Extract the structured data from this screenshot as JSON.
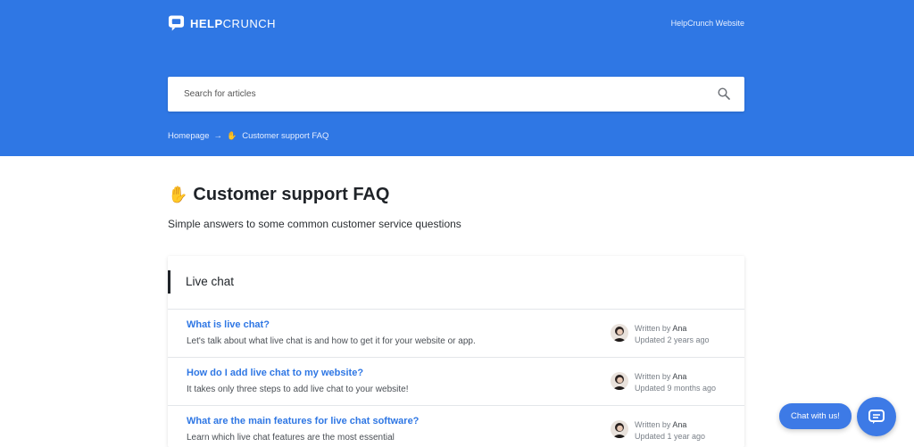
{
  "header": {
    "logo_bold": "HELP",
    "logo_light": "CRUNCH",
    "site_link": "HelpCrunch Website"
  },
  "search": {
    "placeholder": "Search for articles",
    "icon": "search-icon"
  },
  "breadcrumb": {
    "home": "Homepage",
    "separator": "→",
    "emoji": "✋",
    "current": "Customer support FAQ"
  },
  "page": {
    "emoji": "✋",
    "title": "Customer support FAQ",
    "subtitle": "Simple answers to some common customer service questions"
  },
  "section": {
    "label": "Live chat",
    "articles": [
      {
        "title": "What is live chat?",
        "description": "Let's talk about what live chat is and how to get it for your website or app.",
        "written_by": "Written by",
        "author": "Ana",
        "updated": "Updated 2 years ago"
      },
      {
        "title": "How do I add live chat to my website?",
        "description": "It takes only three steps to add live chat to your website!",
        "written_by": "Written by",
        "author": "Ana",
        "updated": "Updated 9 months ago"
      },
      {
        "title": "What are the main features for live chat software?",
        "description": "Learn which live chat features are the most essential",
        "written_by": "Written by",
        "author": "Ana",
        "updated": "Updated 1 year ago"
      }
    ]
  },
  "chat_widget": {
    "bubble_label": "Chat with us!",
    "launcher_icon": "chat-icon"
  },
  "colors": {
    "brand_blue": "#2f77e4",
    "link_blue": "#2f77e4",
    "widget_blue": "#3d7ae6"
  }
}
